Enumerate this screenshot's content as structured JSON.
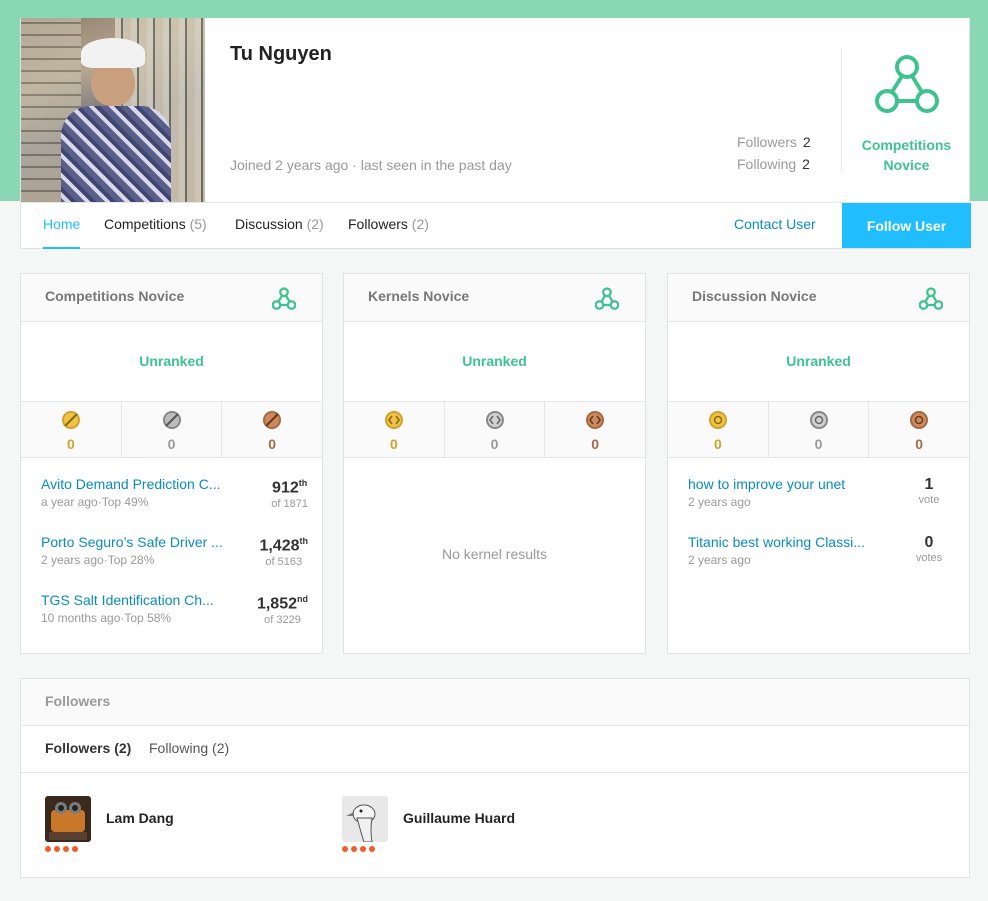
{
  "profile": {
    "name": "Tu Nguyen",
    "joined": "Joined 2 years ago · last seen in the past day",
    "followers_label": "Followers",
    "followers_count": "2",
    "following_label": "Following",
    "following_count": "2",
    "tier_line1": "Competitions",
    "tier_line2": "Novice"
  },
  "tabs": [
    {
      "label": "Home",
      "count": ""
    },
    {
      "label": "Competitions",
      "count": "(5)"
    },
    {
      "label": "Discussion",
      "count": "(2)"
    },
    {
      "label": "Followers",
      "count": "(2)"
    }
  ],
  "actions": {
    "contact": "Contact User",
    "follow": "Follow User"
  },
  "panels": {
    "competitions": {
      "title": "Competitions Novice",
      "rank": "Unranked",
      "medals": {
        "gold": "0",
        "silver": "0",
        "bronze": "0"
      },
      "items": [
        {
          "title": "Avito Demand Prediction C...",
          "sub": "a year ago·Top 49%",
          "rank": "912",
          "suffix": "th",
          "of": "of 1871"
        },
        {
          "title": "Porto Seguro’s Safe Driver ...",
          "sub": "2 years ago·Top 28%",
          "rank": "1,428",
          "suffix": "th",
          "of": "of 5163"
        },
        {
          "title": "TGS Salt Identification Ch...",
          "sub": "10 months ago·Top 58%",
          "rank": "1,852",
          "suffix": "nd",
          "of": "of 3229"
        }
      ]
    },
    "kernels": {
      "title": "Kernels Novice",
      "rank": "Unranked",
      "medals": {
        "gold": "0",
        "silver": "0",
        "bronze": "0"
      },
      "empty": "No kernel results"
    },
    "discussion": {
      "title": "Discussion Novice",
      "rank": "Unranked",
      "medals": {
        "gold": "0",
        "silver": "0",
        "bronze": "0"
      },
      "items": [
        {
          "title": "how to improve your unet",
          "sub": "2 years ago",
          "votes": "1",
          "votes_label": "vote"
        },
        {
          "title": "Titanic best working Classi...",
          "sub": "2 years ago",
          "votes": "0",
          "votes_label": "votes"
        }
      ]
    }
  },
  "followers_section": {
    "title": "Followers",
    "tab_followers": "Followers (2)",
    "tab_following": "Following (2)",
    "people": [
      {
        "name": "Lam Dang"
      },
      {
        "name": "Guillaume Huard"
      }
    ]
  },
  "colors": {
    "accent": "#20beff",
    "tier_green": "#3ec28f",
    "hero_green": "#89d7b3",
    "gold": "#d2a229",
    "bronze": "#a46a45",
    "novice_dots": "#f25c29"
  }
}
